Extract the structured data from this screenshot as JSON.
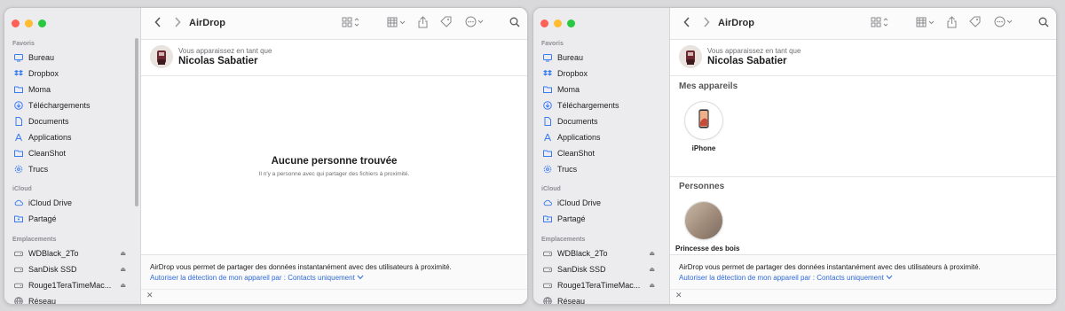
{
  "sidebar": {
    "favorites_header": "Favoris",
    "favorites": [
      {
        "label": "Bureau",
        "icon": "desktop-icon"
      },
      {
        "label": "Dropbox",
        "icon": "dropbox-icon"
      },
      {
        "label": "Moma",
        "icon": "folder-icon"
      },
      {
        "label": "Téléchargements",
        "icon": "downloads-icon"
      },
      {
        "label": "Documents",
        "icon": "document-icon"
      },
      {
        "label": "Applications",
        "icon": "applications-icon"
      },
      {
        "label": "CleanShot",
        "icon": "folder-icon"
      },
      {
        "label": "Trucs",
        "icon": "gear-icon"
      }
    ],
    "icloud_header": "iCloud",
    "icloud": [
      {
        "label": "iCloud Drive",
        "icon": "cloud-icon"
      },
      {
        "label": "Partagé",
        "icon": "shared-folder-icon"
      }
    ],
    "locations_header": "Emplacements",
    "locations": [
      {
        "label": "WDBlack_2To",
        "icon": "drive-icon",
        "eject": "⏏"
      },
      {
        "label": "SanDisk SSD",
        "icon": "drive-icon",
        "eject": "⏏"
      },
      {
        "label": "Rouge1TeraTimeMac...",
        "icon": "drive-icon",
        "eject": "⏏"
      },
      {
        "label": "Réseau",
        "icon": "network-icon"
      }
    ]
  },
  "toolbar": {
    "title": "AirDrop"
  },
  "me": {
    "caption": "Vous apparaissez en tant que",
    "name": "Nicolas Sabatier"
  },
  "empty": {
    "title": "Aucune personne trouvée",
    "subtitle": "Il n'y a personne avec qui partager des fichiers à proximité."
  },
  "sections": {
    "devices_title": "Mes appareils",
    "people_title": "Personnes",
    "device_name": "iPhone",
    "person_name": "Princesse des bois"
  },
  "footer": {
    "text": "AirDrop vous permet de partager des données instantanément avec des utilisateurs à proximité.",
    "link": "Autoriser la détection de mon appareil par : Contacts uniquement",
    "close": "✕"
  },
  "colors": {
    "accent": "#2f6bd8",
    "sidebar_icon": "#3a7cf0"
  }
}
